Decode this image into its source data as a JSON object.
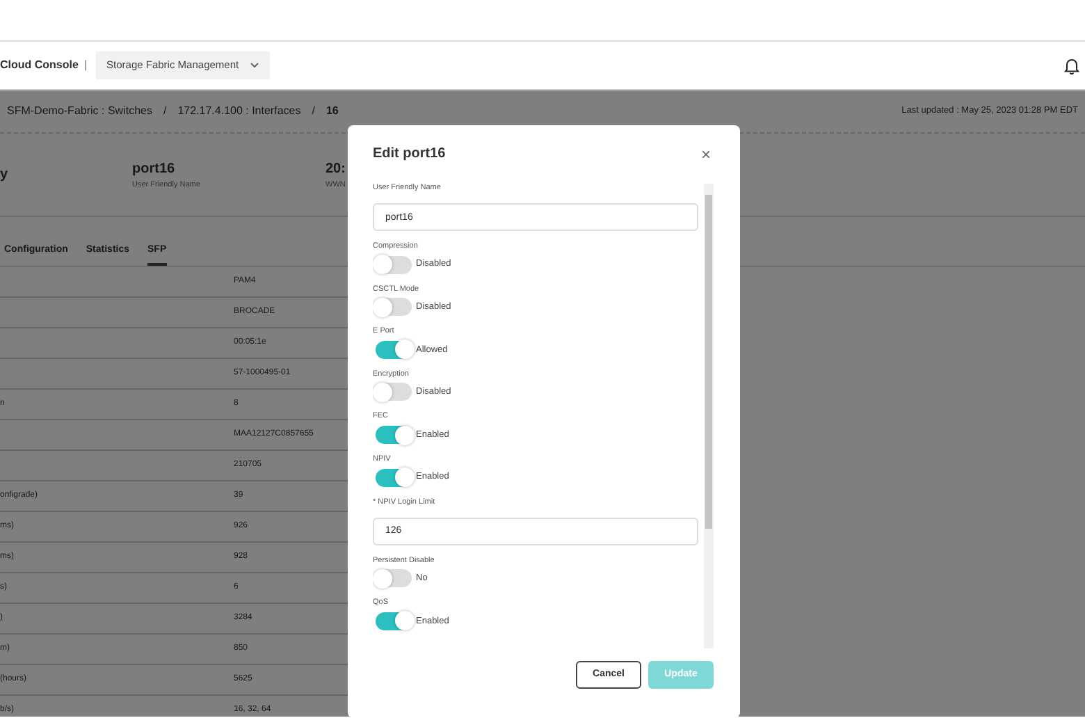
{
  "header": {
    "brand": "Cloud Console",
    "separator": "|",
    "app_menu": "Storage Fabric Management"
  },
  "breadcrumb": [
    {
      "text": "SFM-Demo-Fabric : Switches",
      "current": false
    },
    {
      "text": "/",
      "current": false
    },
    {
      "text": "172.17.4.100 : Interfaces",
      "current": false
    },
    {
      "text": "/",
      "current": false
    },
    {
      "text": "16",
      "current": true
    }
  ],
  "last_updated": {
    "label": "Last updated :",
    "value": "May 25, 2023 01:28 PM EDT"
  },
  "summary": [
    {
      "value": "y"
    },
    {
      "value": "port16",
      "caption": "User Friendly Name"
    },
    {
      "value": "20:",
      "caption": "WWN"
    }
  ],
  "tabs": [
    {
      "label": "Configuration",
      "selected": false
    },
    {
      "label": "Statistics",
      "selected": false
    },
    {
      "label": "SFP",
      "selected": true
    }
  ],
  "table": {
    "rows": [
      {
        "value": "PAM4"
      },
      {
        "value": "BROCADE"
      },
      {
        "value": "00:05:1e"
      },
      {
        "value": "57-1000495-01"
      },
      {
        "label": "n",
        "value": "8"
      },
      {
        "value": "MAA12127C0857655"
      },
      {
        "value": "210705"
      },
      {
        "label": "onfigrade)",
        "value": "39"
      },
      {
        "label": "ms)",
        "value": "926"
      },
      {
        "label": "ms)",
        "value": "928"
      },
      {
        "label": "s)",
        "value": "6"
      },
      {
        "label": ")",
        "value": "3284"
      },
      {
        "label": "m)",
        "value": "850"
      },
      {
        "label": "(hours)",
        "value": "5625"
      },
      {
        "label": "b/s)",
        "value": "16, 32, 64"
      }
    ]
  },
  "modal": {
    "title": "Edit port16",
    "close": "×",
    "fields": [
      {
        "kind": "text",
        "label": "User Friendly Name",
        "value": "port16"
      },
      {
        "kind": "toggle",
        "label": "Compression",
        "on": false,
        "state_text": "Disabled"
      },
      {
        "kind": "toggle",
        "label": "CSCTL Mode",
        "on": false,
        "state_text": "Disabled"
      },
      {
        "kind": "toggle",
        "label": "E Port",
        "on": true,
        "state_text": "Allowed"
      },
      {
        "kind": "toggle",
        "label": "Encryption",
        "on": false,
        "state_text": "Disabled"
      },
      {
        "kind": "toggle",
        "label": "FEC",
        "on": true,
        "state_text": "Enabled"
      },
      {
        "kind": "toggle",
        "label": "NPIV",
        "on": true,
        "state_text": "Enabled"
      },
      {
        "kind": "text",
        "label": "* NPIV Login Limit",
        "value": "126"
      },
      {
        "kind": "toggle",
        "label": "Persistent Disable",
        "on": false,
        "state_text": "No"
      },
      {
        "kind": "toggle",
        "label": "QoS",
        "on": true,
        "state_text": "Enabled"
      }
    ],
    "buttons": [
      {
        "label": "Cancel",
        "kind": "secondary"
      },
      {
        "label": "Update",
        "kind": "primary",
        "disabled": true
      }
    ]
  }
}
